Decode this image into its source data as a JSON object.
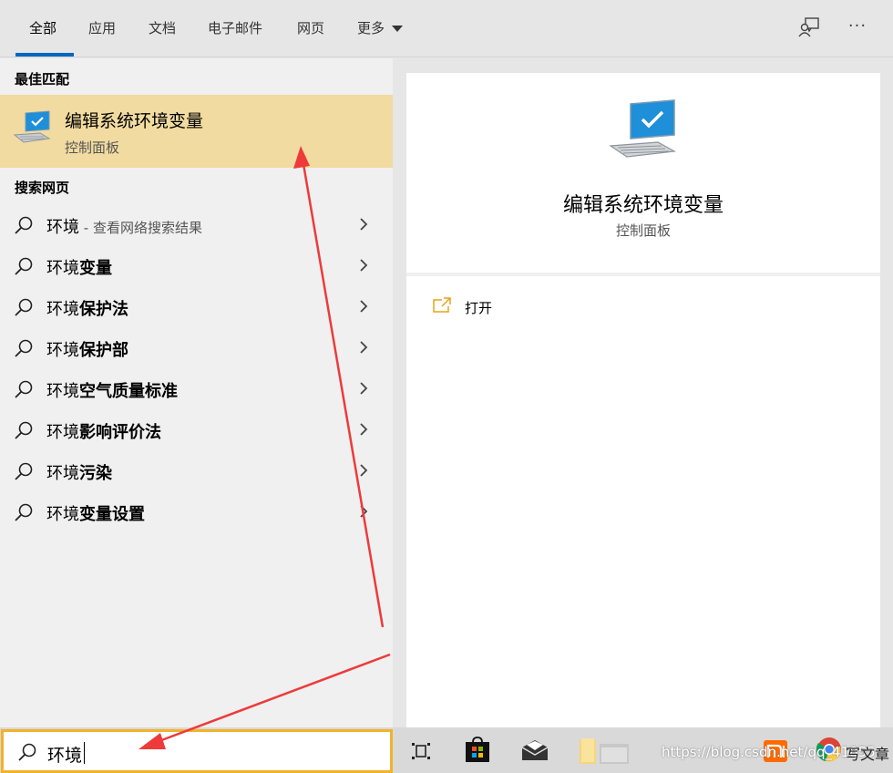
{
  "tabs": {
    "all": "全部",
    "apps": "应用",
    "docs": "文档",
    "email": "电子邮件",
    "web": "网页",
    "more": "更多"
  },
  "top_actions": {
    "more_options": "···"
  },
  "best_match": {
    "header": "最佳匹配",
    "title": "编辑系统环境变量",
    "subtitle": "控制面板"
  },
  "web_search": {
    "header": "搜索网页",
    "items": [
      {
        "prefix": "环境",
        "bold": "",
        "hint": " - 查看网络搜索结果"
      },
      {
        "prefix": "环境",
        "bold": "变量",
        "hint": ""
      },
      {
        "prefix": "环境",
        "bold": "保护法",
        "hint": ""
      },
      {
        "prefix": "环境",
        "bold": "保护部",
        "hint": ""
      },
      {
        "prefix": "环境",
        "bold": "空气质量标准",
        "hint": ""
      },
      {
        "prefix": "环境",
        "bold": "影响评价法",
        "hint": ""
      },
      {
        "prefix": "环境",
        "bold": "污染",
        "hint": ""
      },
      {
        "prefix": "环境",
        "bold": "变量设置",
        "hint": ""
      }
    ]
  },
  "detail": {
    "title": "编辑系统环境变量",
    "subtitle": "控制面板",
    "open_label": "打开"
  },
  "search": {
    "value": "环境"
  },
  "taskbar": {
    "watermark": "https://blog.csdn.net/qq_41855",
    "write_article": "写文章"
  },
  "colors": {
    "accent": "#0067c0",
    "selected_bg": "#f1dba0",
    "search_border": "#f3b22a",
    "annotation": "#ee3a3a"
  }
}
